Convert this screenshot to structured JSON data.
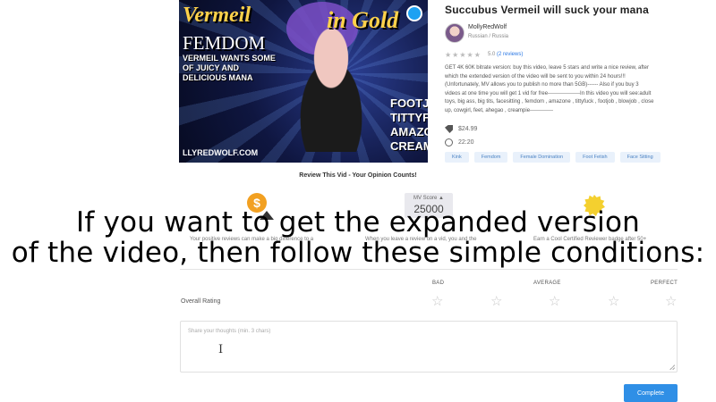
{
  "thumbnail": {
    "title": "Vermeil",
    "title2": "in Gold",
    "femdom": "FEMDOM",
    "subtitle": "VERMEIL WANTS SOME OF JUICY AND DELICIOUS MANA",
    "right_lines": [
      "FOOTJ",
      "TITTYFU",
      "AMAZO",
      "CREAM"
    ],
    "watermark": "LLYREDWOLF.COM"
  },
  "product": {
    "title": "Succubus Vermeil will suck your mana",
    "seller": "MollyRedWolf",
    "language": "Russian / Russia",
    "stars": "★★★★★",
    "rating": "5.0",
    "reviews_link": "(2 reviews)",
    "description": "GET 4K 60K bitrate version: buy this video, leave 5 stars and write a nice review, after which the extended version of the video will be sent to you within 24 hours!!! (Unfortunately, MV allows you to publish no more than 5GB)------ Also if you buy 3 videos at one time you will get 1 vid for free------------------In this video you will see:adult toys, big ass, big tits, facesitting , femdom , amazone , tittyfuck , footjob , blowjob , close up, cowgirl, feet, ahegao , creampie-------------",
    "price": "$24.99",
    "duration": "22:20",
    "tags": [
      "Kink",
      "Femdom",
      "Female Domination",
      "Foot Fetish",
      "Face Sitting"
    ]
  },
  "review": {
    "heading": "Review This Vid - Your Opinion Counts!",
    "mv_label": "MV Score ▲",
    "mv_score": "25000",
    "info": [
      "Your positive reviews can make a big difference to a",
      "When you leave a review on a vid, you and the",
      "Earn a Cool Certified Reviewer badge after 50+"
    ],
    "scale": [
      "BAD",
      "AVERAGE",
      "PERFECT"
    ],
    "overall_label": "Overall Rating",
    "placeholder": "Share your thoughts (min. 3 chars)",
    "submit": "Complete"
  },
  "overlay": {
    "line1": "If you want to get the expanded version",
    "line2": "of the video, then follow these simple conditions:"
  }
}
